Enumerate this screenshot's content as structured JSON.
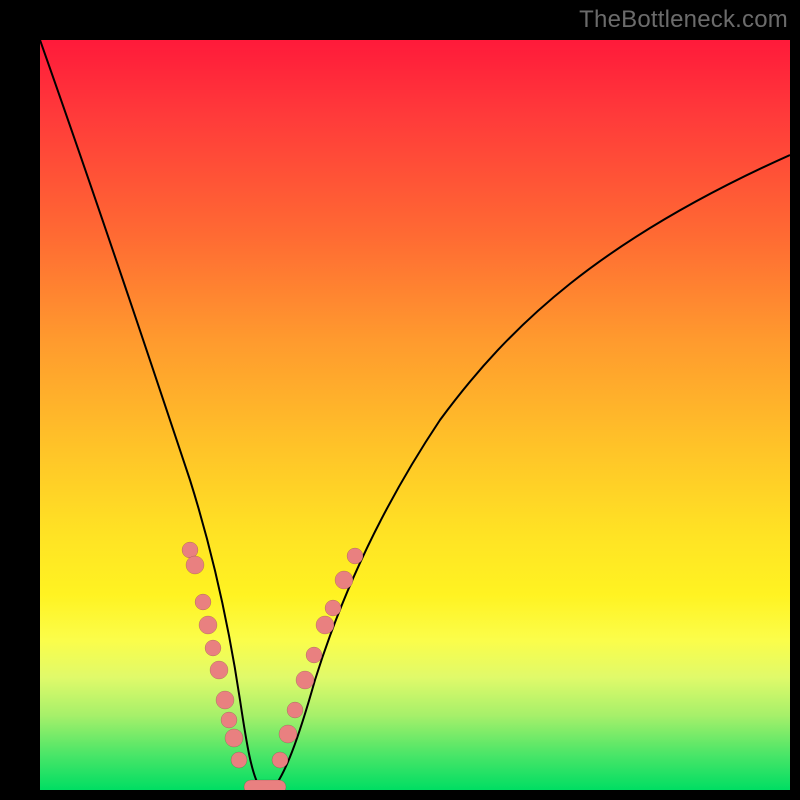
{
  "watermark": "TheBottleneck.com",
  "colors": {
    "frame": "#000000",
    "gradient_top": "#ff1a3a",
    "gradient_bottom": "#00de63",
    "curve": "#000000",
    "dots": "#e98080"
  },
  "chart_data": {
    "type": "line",
    "title": "",
    "xlabel": "",
    "ylabel": "",
    "xlim": [
      0,
      100
    ],
    "ylim": [
      0,
      100
    ],
    "x": [
      0,
      5,
      10,
      15,
      20,
      23,
      25,
      27,
      29,
      30,
      33,
      36,
      40,
      45,
      50,
      55,
      60,
      70,
      80,
      90,
      100
    ],
    "values": [
      100,
      84,
      67,
      50,
      32,
      20,
      12,
      4,
      0,
      0,
      6,
      14,
      24,
      34,
      43,
      50,
      56,
      66,
      74,
      80,
      85
    ],
    "annotations": {
      "dots_left_branch": [
        {
          "x": 20.0,
          "y": 32
        },
        {
          "x": 20.7,
          "y": 30
        },
        {
          "x": 21.8,
          "y": 25
        },
        {
          "x": 22.4,
          "y": 22
        },
        {
          "x": 23.0,
          "y": 19
        },
        {
          "x": 23.8,
          "y": 16
        },
        {
          "x": 24.7,
          "y": 12
        },
        {
          "x": 25.2,
          "y": 9
        },
        {
          "x": 25.8,
          "y": 7
        },
        {
          "x": 26.5,
          "y": 4
        }
      ],
      "dots_right_branch": [
        {
          "x": 32.0,
          "y": 4
        },
        {
          "x": 33.0,
          "y": 8
        },
        {
          "x": 34.0,
          "y": 11
        },
        {
          "x": 35.3,
          "y": 15
        },
        {
          "x": 36.5,
          "y": 18
        },
        {
          "x": 38.0,
          "y": 22
        },
        {
          "x": 39.0,
          "y": 24
        },
        {
          "x": 40.5,
          "y": 28
        },
        {
          "x": 42.0,
          "y": 31
        }
      ],
      "valley_pill": {
        "x_start": 27,
        "x_end": 31,
        "y": 0
      }
    }
  }
}
